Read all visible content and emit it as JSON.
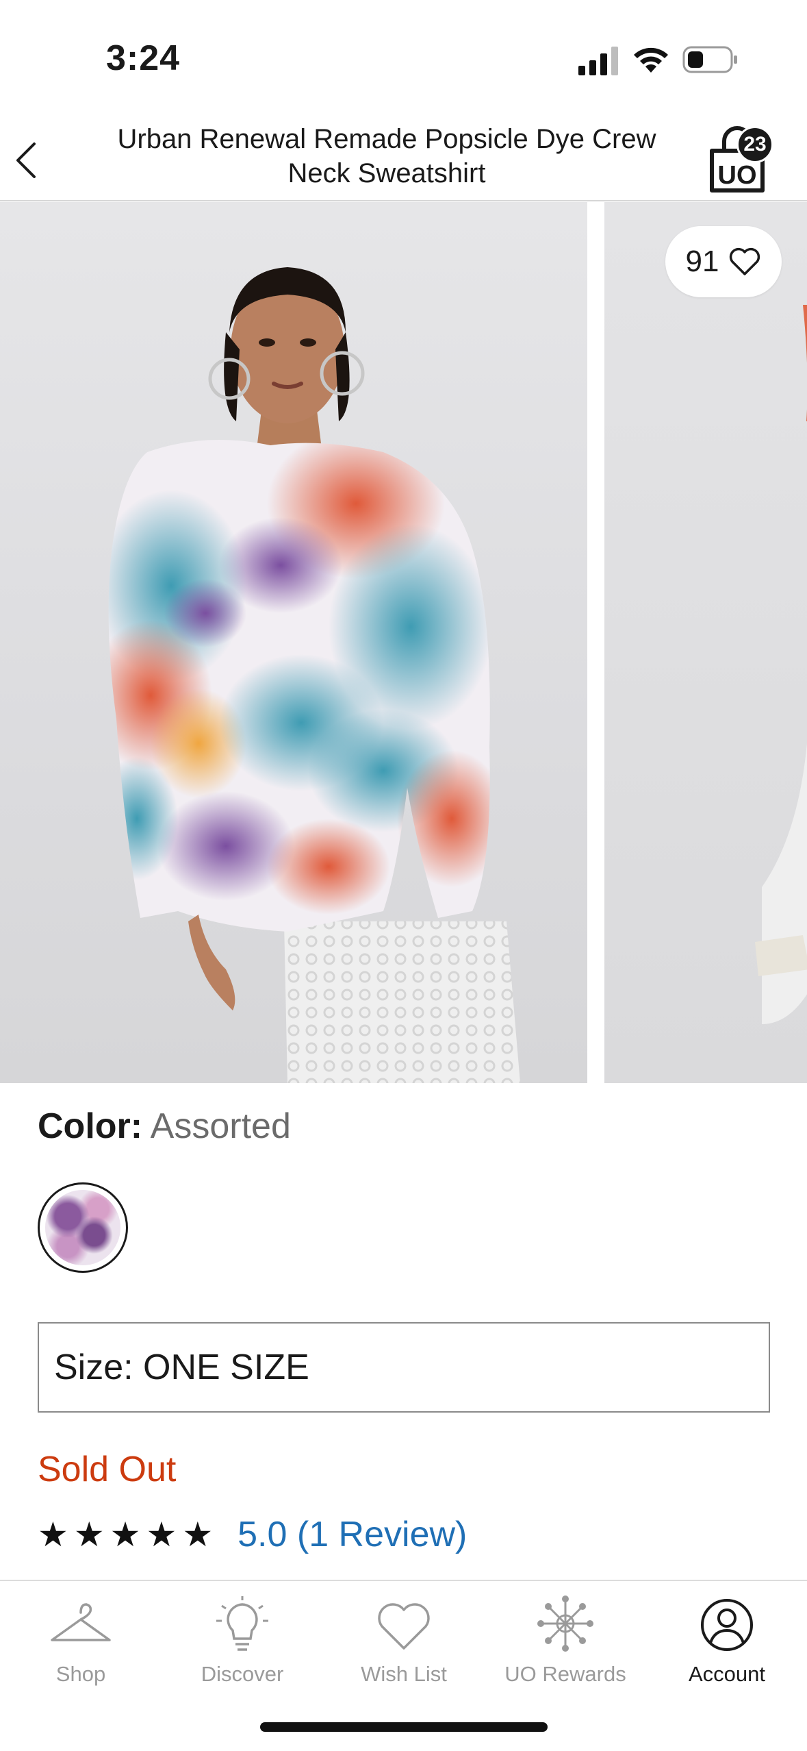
{
  "status_bar": {
    "time": "3:24"
  },
  "header": {
    "title": "Urban Renewal Remade Popsicle Dye Crew Neck Sweatshirt",
    "cart_count": "23",
    "cart_logo": "UO"
  },
  "carousel": {
    "wish_count": "91"
  },
  "product": {
    "color_label": "Color:",
    "color_value": "Assorted",
    "size_text": "Size: ONE SIZE",
    "availability": "Sold Out",
    "rating_stars": 5,
    "review_text": "5.0 (1 Review)"
  },
  "tabs": [
    {
      "label": "Shop",
      "icon": "hanger-icon",
      "active": false
    },
    {
      "label": "Discover",
      "icon": "lightbulb-icon",
      "active": false
    },
    {
      "label": "Wish List",
      "icon": "heart-icon",
      "active": false
    },
    {
      "label": "UO Rewards",
      "icon": "rewards-icon",
      "active": false
    },
    {
      "label": "Account",
      "icon": "account-icon",
      "active": true
    }
  ],
  "colors": {
    "sold_out": "#cc3b0f",
    "link": "#1f6fb5",
    "inactive_tab": "#9a9a9a"
  }
}
